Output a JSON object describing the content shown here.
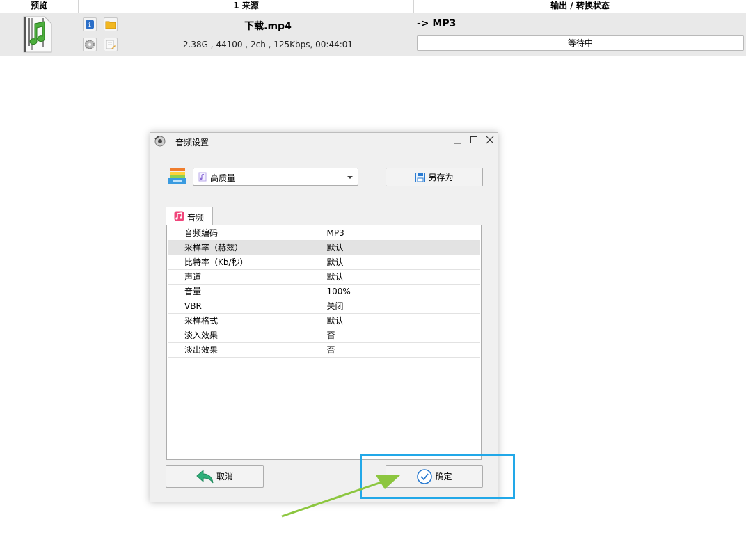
{
  "list": {
    "headers": {
      "preview": "预览",
      "source": "1 来源",
      "output": "输出 / 转换状态"
    },
    "file": {
      "name": "下载.mp4",
      "meta": "2.38G , 44100 , 2ch , 125Kbps, 00:44:01",
      "output_format": "-> MP3",
      "status": "等待中"
    },
    "icons": [
      "music-file-icon",
      "info-icon",
      "folder-icon",
      "settings-gear-icon",
      "edit-file-icon"
    ]
  },
  "dialog": {
    "title": "音频设置",
    "profile": {
      "selected": "高质量"
    },
    "save_as_label": "另存为",
    "tab_label": "音频",
    "properties": [
      {
        "name": "音频编码",
        "value": "MP3"
      },
      {
        "name": "采样率（赫兹）",
        "value": "默认"
      },
      {
        "name": "比特率（Kb/秒）",
        "value": "默认"
      },
      {
        "name": "声道",
        "value": "默认"
      },
      {
        "name": "音量",
        "value": "100%"
      },
      {
        "name": "VBR",
        "value": "关闭"
      },
      {
        "name": "采样格式",
        "value": "默认"
      },
      {
        "name": "淡入效果",
        "value": "否"
      },
      {
        "name": "淡出效果",
        "value": "否"
      }
    ],
    "cancel_label": "取消",
    "ok_label": "确定"
  },
  "colors": {
    "highlight": "#22a8e8",
    "arrow": "#8cc63f",
    "selected_row": "#e3e3e3"
  }
}
